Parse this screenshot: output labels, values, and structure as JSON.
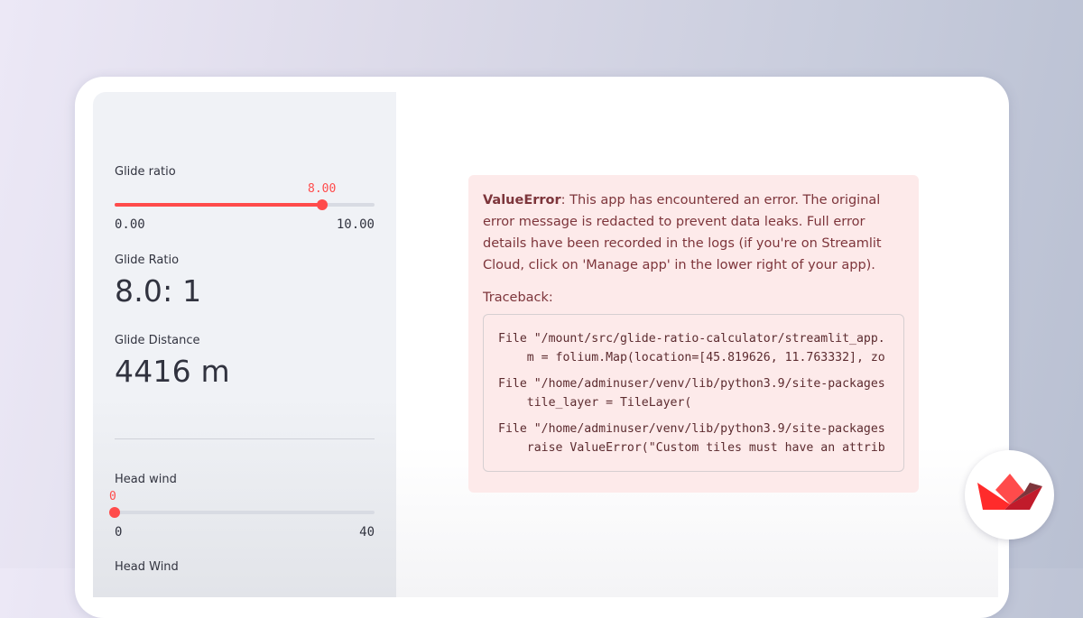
{
  "sidebar": {
    "glide_ratio_slider": {
      "label": "Glide ratio",
      "value": "8.00",
      "min": "0.00",
      "max": "10.00",
      "fraction": 0.8
    },
    "glide_ratio_metric": {
      "label": "Glide Ratio",
      "value": "8.0: 1"
    },
    "glide_distance_metric": {
      "label": "Glide Distance",
      "value": "4416 m"
    },
    "head_wind_slider": {
      "label": "Head wind",
      "value": "0",
      "min": "0",
      "max": "40",
      "fraction": 0
    },
    "head_wind_metric": {
      "label": "Head Wind"
    }
  },
  "error": {
    "type": "ValueError",
    "message": ": This app has encountered an error. The original error message is redacted to prevent data leaks. Full error details have been recorded in the logs (if you're on Streamlit Cloud, click on 'Manage app' in the lower right of your app).",
    "traceback_label": "Traceback:",
    "traceback": [
      "File \"/mount/src/glide-ratio-calculator/streamlit_app.",
      "    m = folium.Map(location=[45.819626, 11.763332], zo",
      "File \"/home/adminuser/venv/lib/python3.9/site-packages",
      "    tile_layer = TileLayer(",
      "File \"/home/adminuser/venv/lib/python3.9/site-packages",
      "    raise ValueError(\"Custom tiles must have an attrib"
    ]
  },
  "colors": {
    "accent": "#ff4b4b",
    "error_bg": "#fdeaea",
    "error_text": "#7d353b",
    "sidebar_bg": "#f0f2f6"
  },
  "icons": {
    "badge": "streamlit-logo-icon"
  }
}
